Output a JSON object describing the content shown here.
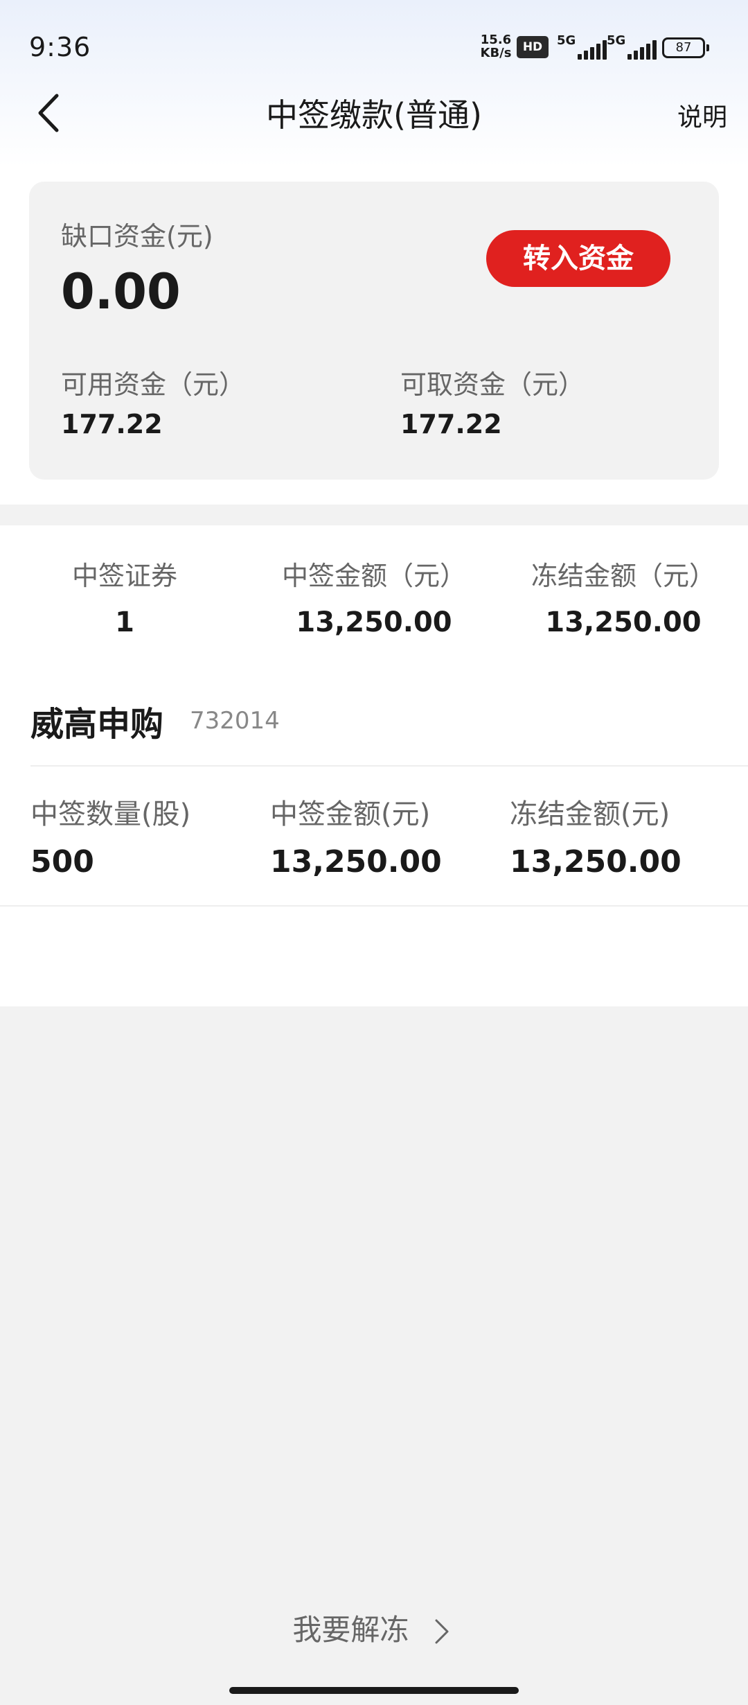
{
  "status_bar": {
    "time": "9:36",
    "net_speed_value": "15.6",
    "net_speed_unit": "KB/s",
    "hd_label": "HD",
    "sim1_label": "5G",
    "sim2_label": "5G",
    "battery_level": "87"
  },
  "nav": {
    "title": "中签缴款(普通)",
    "help_label": "说明",
    "back_icon": "chevron-left-icon"
  },
  "fund_card": {
    "shortfall_label": "缺口资金(元)",
    "shortfall_value": "0.00",
    "transfer_button": "转入资金",
    "available_label": "可用资金（元）",
    "available_value": "177.22",
    "withdrawable_label": "可取资金（元）",
    "withdrawable_value": "177.22"
  },
  "summary": {
    "items": [
      {
        "label": "中签证券",
        "value": "1"
      },
      {
        "label": "中签金额（元）",
        "value": "13,250.00"
      },
      {
        "label": "冻结金额（元）",
        "value": "13,250.00"
      }
    ]
  },
  "stock": {
    "name": "威高申购",
    "code": "732014",
    "details": [
      {
        "label": "中签数量(股)",
        "value": "500"
      },
      {
        "label": "中签金额(元)",
        "value": "13,250.00"
      },
      {
        "label": "冻结金额(元)",
        "value": "13,250.00"
      }
    ]
  },
  "footer": {
    "unfreeze_label": "我要解冻",
    "chevron_icon": "chevron-right-icon"
  },
  "colors": {
    "accent_red": "#e0211f",
    "card_bg": "#f2f2f2",
    "label_gray": "#666666"
  }
}
